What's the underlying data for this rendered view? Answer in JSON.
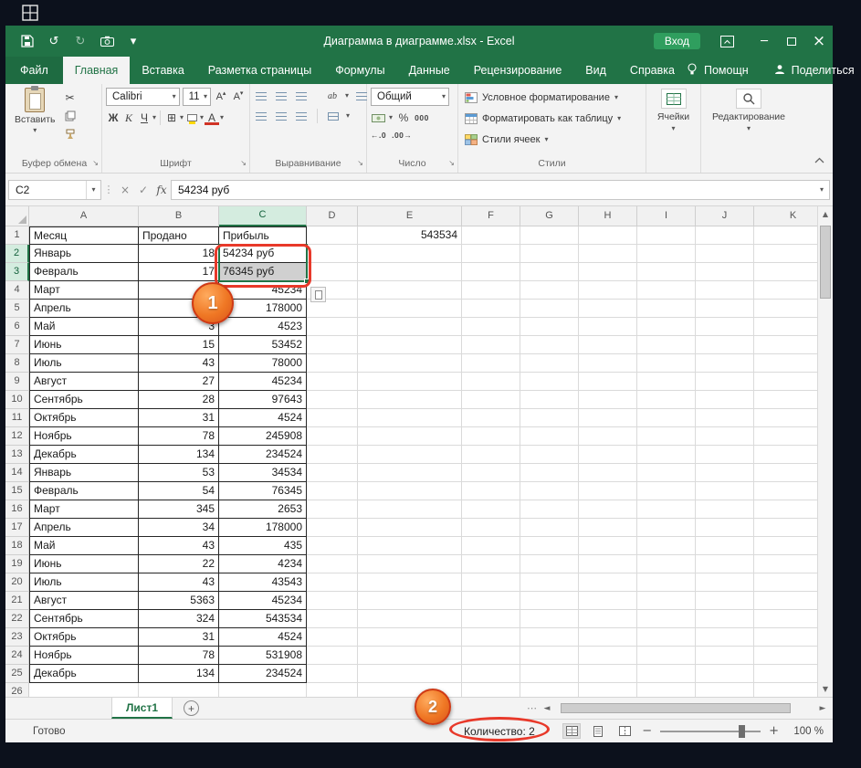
{
  "window": {
    "title": "Диаграмма в диаграмме.xlsx - Excel",
    "sign_in": "Вход"
  },
  "ribbon": {
    "file_tab": "Файл",
    "tabs": [
      {
        "label": "Главная",
        "active": true
      },
      {
        "label": "Вставка"
      },
      {
        "label": "Разметка страницы"
      },
      {
        "label": "Формулы"
      },
      {
        "label": "Данные"
      },
      {
        "label": "Рецензирование"
      },
      {
        "label": "Вид"
      },
      {
        "label": "Справка"
      }
    ],
    "help_label": "Помощн",
    "share_label": "Поделиться",
    "clipboard": {
      "paste_label": "Вставить",
      "group_label": "Буфер обмена"
    },
    "font": {
      "name": "Calibri",
      "size": "11",
      "bold": "Ж",
      "italic": "К",
      "underline": "Ч",
      "group_label": "Шрифт"
    },
    "alignment": {
      "orientation_label": "ab",
      "group_label": "Выравнивание"
    },
    "number": {
      "format": "Общий",
      "percent": "%",
      "thousands": "000",
      "inc_decimal": "←.0",
      "dec_decimal": ".00→",
      "group_label": "Число"
    },
    "styles": {
      "items": [
        "Условное форматирование",
        "Форматировать как таблицу",
        "Стили ячеек"
      ],
      "group_label": "Стили"
    },
    "cells": {
      "group_label": "Ячейки"
    },
    "editing": {
      "group_label": "Редактирование"
    }
  },
  "formula_bar": {
    "name_box": "C2",
    "fx_label": "fx",
    "value": "54234 руб"
  },
  "sheet": {
    "columns": [
      "A",
      "B",
      "C",
      "D",
      "E",
      "F",
      "G",
      "H",
      "I",
      "J",
      "K"
    ],
    "selected_column": "C",
    "selected_rows": [
      2,
      3
    ],
    "active_cell": "C2",
    "rows": [
      {
        "n": "1",
        "A": "Месяц",
        "B": "Продано",
        "C": "Прибыль",
        "E": "543534"
      },
      {
        "n": "2",
        "A": "Январь",
        "B": "18",
        "C": "54234 руб"
      },
      {
        "n": "3",
        "A": "Февраль",
        "B": "17",
        "C": "76345 руб"
      },
      {
        "n": "4",
        "A": "Март",
        "B": "",
        "C": "45234"
      },
      {
        "n": "5",
        "A": "Апрель",
        "B": "",
        "C": "178000"
      },
      {
        "n": "6",
        "A": "Май",
        "B": "3",
        "C": "4523"
      },
      {
        "n": "7",
        "A": "Июнь",
        "B": "15",
        "C": "53452"
      },
      {
        "n": "8",
        "A": "Июль",
        "B": "43",
        "C": "78000"
      },
      {
        "n": "9",
        "A": "Август",
        "B": "27",
        "C": "45234"
      },
      {
        "n": "10",
        "A": "Сентябрь",
        "B": "28",
        "C": "97643"
      },
      {
        "n": "11",
        "A": "Октябрь",
        "B": "31",
        "C": "4524"
      },
      {
        "n": "12",
        "A": "Ноябрь",
        "B": "78",
        "C": "245908"
      },
      {
        "n": "13",
        "A": "Декабрь",
        "B": "134",
        "C": "234524"
      },
      {
        "n": "14",
        "A": "Январь",
        "B": "53",
        "C": "34534"
      },
      {
        "n": "15",
        "A": "Февраль",
        "B": "54",
        "C": "76345"
      },
      {
        "n": "16",
        "A": "Март",
        "B": "345",
        "C": "2653"
      },
      {
        "n": "17",
        "A": "Апрель",
        "B": "34",
        "C": "178000"
      },
      {
        "n": "18",
        "A": "Май",
        "B": "43",
        "C": "435"
      },
      {
        "n": "19",
        "A": "Июнь",
        "B": "22",
        "C": "4234"
      },
      {
        "n": "20",
        "A": "Июль",
        "B": "43",
        "C": "43543"
      },
      {
        "n": "21",
        "A": "Август",
        "B": "5363",
        "C": "45234"
      },
      {
        "n": "22",
        "A": "Сентябрь",
        "B": "324",
        "C": "543534"
      },
      {
        "n": "23",
        "A": "Октябрь",
        "B": "31",
        "C": "4524"
      },
      {
        "n": "24",
        "A": "Ноябрь",
        "B": "78",
        "C": "531908"
      },
      {
        "n": "25",
        "A": "Декабрь",
        "B": "134",
        "C": "234524"
      },
      {
        "n": "26",
        "A": "",
        "B": "",
        "C": ""
      }
    ]
  },
  "sheet_tabs": {
    "active_sheet": "Лист1"
  },
  "status_bar": {
    "mode": "Готово",
    "selection_count": "Количество: 2",
    "zoom_level": "100 %"
  },
  "annotations": {
    "step_1": "1",
    "step_2": "2"
  },
  "colors": {
    "excel_green": "#217346",
    "annotation_red": "#e8392a",
    "annotation_orange": "#ef7724",
    "selection_fill": "#d0d0d0"
  }
}
